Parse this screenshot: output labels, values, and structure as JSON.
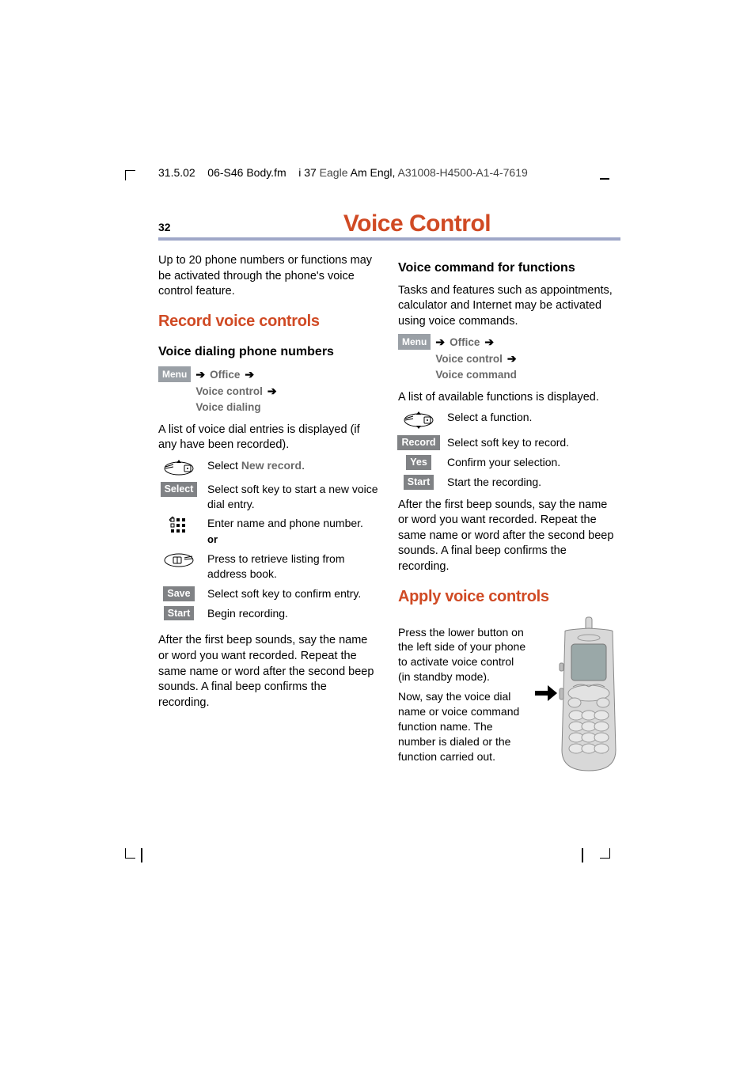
{
  "meta": {
    "date": "31.5.02",
    "file": "06-S46 Body.fm",
    "pagecode": "i 37",
    "product": "Eagle",
    "lang": "Am Engl,",
    "partno": "A31008-H4500-A1-4-7619"
  },
  "pageNumber": "32",
  "title": "Voice Control",
  "intro": "Up to 20 phone numbers or functions may be activated through the phone's voice control feature.",
  "section1": {
    "heading": "Record voice controls",
    "sub1": {
      "heading": "Voice dialing phone numbers",
      "nav": {
        "menu": "Menu",
        "l1a": "Office",
        "l2a": "Voice control",
        "l3a": "Voice dialing"
      },
      "listIntro": "A list of voice dial entries is displayed (if any have been recorded).",
      "steps": {
        "s1": {
          "text_pre": "Select ",
          "bold": "New record",
          "text_post": "."
        },
        "s2": {
          "chip": "Select",
          "text": "Select soft key to start a new voice dial entry."
        },
        "s3": {
          "text": "Enter name and phone number."
        },
        "or": "or",
        "s4": {
          "text": "Press to retrieve listing from address book."
        },
        "s5": {
          "chip": "Save",
          "text": "Select soft key to confirm entry."
        },
        "s6": {
          "chip": "Start",
          "text": "Begin recording."
        }
      },
      "after": "After the first beep sounds, say the name or word you want recorded. Repeat the same name or word after the second beep sounds. A final beep confirms the recording."
    },
    "sub2": {
      "heading": "Voice command for functions",
      "intro": "Tasks and features such as appointments, calculator and Internet may be activated using voice commands.",
      "nav": {
        "menu": "Menu",
        "l1a": "Office",
        "l2a": "Voice control",
        "l3a": "Voice command"
      },
      "listIntro": "A list of available functions is displayed.",
      "steps": {
        "s1": {
          "text": "Select a function."
        },
        "s2": {
          "chip": "Record",
          "text": "Select soft key to record."
        },
        "s3": {
          "chip": "Yes",
          "text": "Confirm your selection."
        },
        "s4": {
          "chip": "Start",
          "text": "Start the recording."
        }
      },
      "after": "After the first beep sounds, say the name or word you want recorded. Repeat the same name or word after the second beep sounds. A final beep confirms the recording."
    }
  },
  "section2": {
    "heading": "Apply voice controls",
    "p1": "Press the lower button on the left side of your phone to activate voice control (in standby mode).",
    "p2": "Now, say the voice dial name or voice command function name. The number is dialed or the function carried out."
  }
}
